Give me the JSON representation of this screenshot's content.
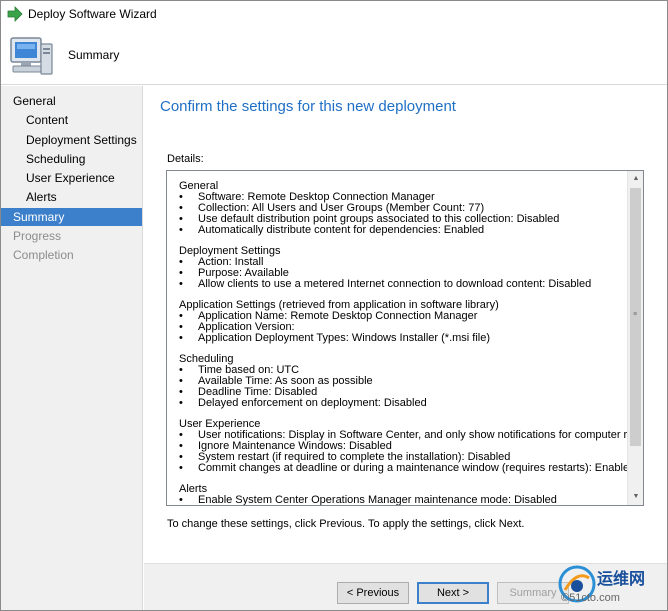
{
  "window": {
    "title": "Deploy Software Wizard"
  },
  "header": {
    "title": "Summary"
  },
  "nav": {
    "items": [
      {
        "label": "General",
        "level": "top",
        "state": "normal"
      },
      {
        "label": "Content",
        "level": "sub",
        "state": "normal"
      },
      {
        "label": "Deployment Settings",
        "level": "sub",
        "state": "normal"
      },
      {
        "label": "Scheduling",
        "level": "sub",
        "state": "normal"
      },
      {
        "label": "User Experience",
        "level": "sub",
        "state": "normal"
      },
      {
        "label": "Alerts",
        "level": "sub",
        "state": "normal"
      },
      {
        "label": "Summary",
        "level": "top",
        "state": "active"
      },
      {
        "label": "Progress",
        "level": "top",
        "state": "disabled"
      },
      {
        "label": "Completion",
        "level": "top",
        "state": "disabled"
      }
    ]
  },
  "main": {
    "heading": "Confirm the settings for this new deployment",
    "details_label": "Details:",
    "footer_note": "To change these settings, click Previous. To apply the settings, click Next.",
    "sections": [
      {
        "title": "General",
        "items": [
          "Software: Remote Desktop Connection Manager",
          "Collection: All Users and User Groups (Member Count: 77)",
          "Use default distribution point groups associated to this collection: Disabled",
          "Automatically distribute content for dependencies: Enabled"
        ]
      },
      {
        "title": "Deployment Settings",
        "items": [
          "Action: Install",
          "Purpose: Available",
          "Allow clients to use a metered Internet connection to download content: Disabled"
        ]
      },
      {
        "title": "Application Settings (retrieved from application in software library)",
        "items": [
          "Application Name: Remote Desktop Connection Manager",
          "Application Version:",
          "Application Deployment Types: Windows Installer (*.msi file)"
        ]
      },
      {
        "title": "Scheduling",
        "items": [
          "Time based on: UTC",
          "Available Time: As soon as possible",
          "Deadline Time: Disabled",
          "Delayed enforcement on deployment: Disabled"
        ]
      },
      {
        "title": "User Experience",
        "items": [
          "User notifications: Display in Software Center, and only show notifications for computer restarts",
          "Ignore Maintenance Windows: Disabled",
          "System restart  (if required to complete the installation): Disabled",
          "Commit changes at deadline or during a maintenance window (requires restarts): Enabled"
        ]
      },
      {
        "title": "Alerts",
        "items": [
          "Enable System Center Operations Manager maintenance mode: Disabled"
        ]
      }
    ]
  },
  "buttons": {
    "previous": "< Previous",
    "next": "Next >",
    "summary": "Summary"
  },
  "watermark": {
    "line1": "运维网",
    "line2": "©51cto.com"
  },
  "colors": {
    "accent": "#3c7fcb",
    "heading": "#1f6fc5",
    "nav_bg": "#f0f0f0",
    "disabled_text": "#8c8c8c"
  }
}
